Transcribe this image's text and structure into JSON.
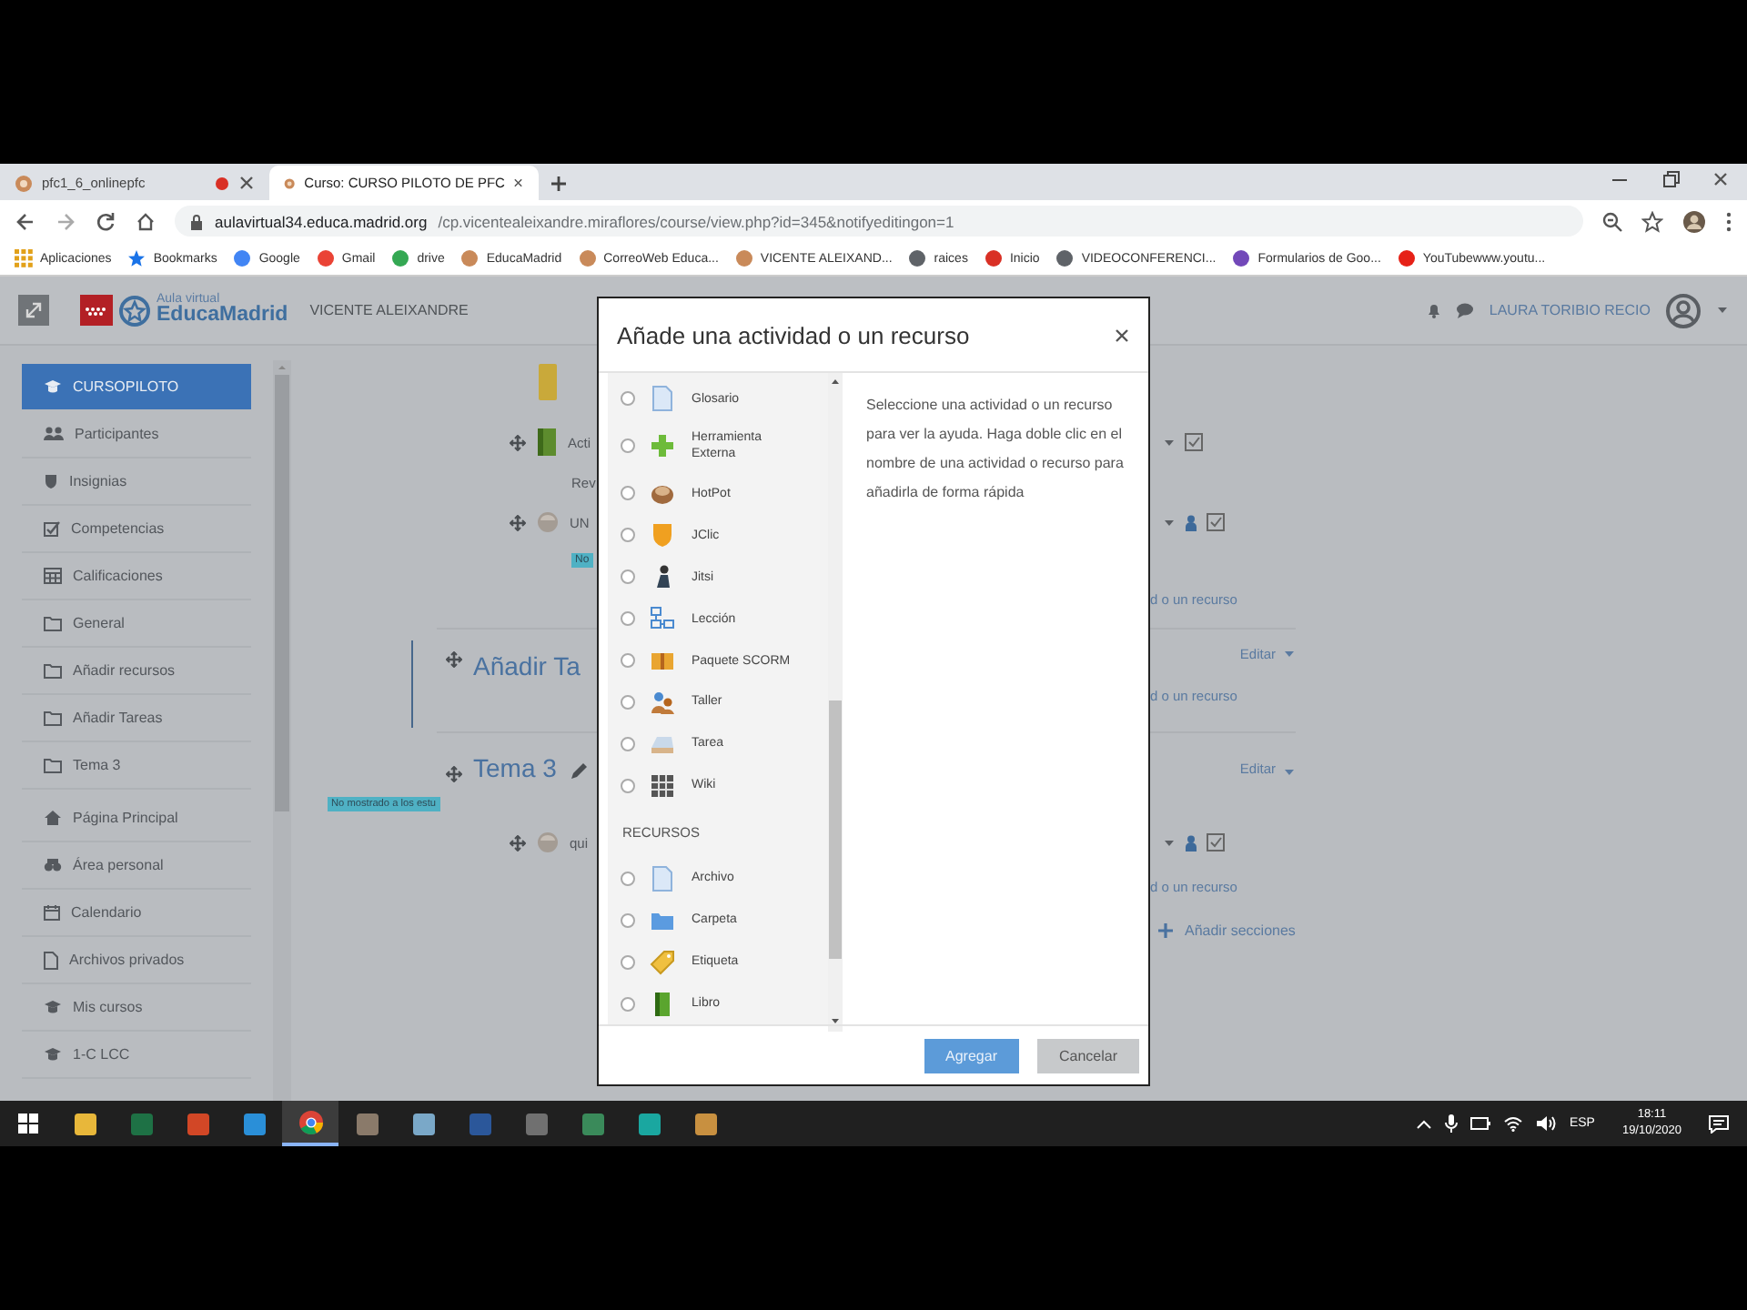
{
  "browser": {
    "tabs": [
      {
        "title": "pfc1_6_onlinepfc",
        "recording": true,
        "selected": false
      },
      {
        "title": "Curso: CURSO PILOTO DE PFC",
        "recording": false,
        "selected": true
      }
    ],
    "url_host": "aulavirtual34.educa.madrid.org",
    "url_path": "/cp.vicentealeixandre.miraflores/course/view.php?id=345&notifyeditingon=1",
    "bookmarks": [
      "Aplicaciones",
      "Bookmarks",
      "Google",
      "Gmail",
      "drive",
      "EducaMadrid",
      "CorreoWeb Educa...",
      "VICENTE ALEIXAND...",
      "raices",
      "Inicio",
      "VIDEOCONFERENCI...",
      "Formularios de Goo...",
      "YouTubewww.youtu..."
    ]
  },
  "header": {
    "logo_small": "Aula virtual",
    "logo": "EducaMadrid",
    "site": "VICENTE ALEIXANDRE",
    "user": "LAURA TORIBIO RECIO"
  },
  "sidebar": {
    "course_items": [
      {
        "label": "CURSOPILOTO",
        "selected": true
      },
      {
        "label": "Participantes",
        "selected": false
      },
      {
        "label": "Insignias",
        "selected": false
      },
      {
        "label": "Competencias",
        "selected": false
      },
      {
        "label": "Calificaciones",
        "selected": false
      },
      {
        "label": "General",
        "selected": false
      },
      {
        "label": "Añadir recursos",
        "selected": false
      },
      {
        "label": "Añadir Tareas",
        "selected": false
      },
      {
        "label": "Tema 3",
        "selected": false
      }
    ],
    "site_items": [
      {
        "label": "Página Principal",
        "selected": false
      },
      {
        "label": "Área personal",
        "selected": false
      },
      {
        "label": "Calendario",
        "selected": false
      },
      {
        "label": "Archivos privados",
        "selected": false
      },
      {
        "label": "Mis cursos",
        "selected": false
      },
      {
        "label": "1-C LCC",
        "selected": false
      }
    ]
  },
  "course": {
    "rows": [
      {
        "kind": "top",
        "left": [
          {
            "kind": "block"
          }
        ],
        "right": []
      },
      {
        "kind": "item",
        "left": [
          {
            "kind": "book",
            "text": "Acti"
          }
        ],
        "right": [
          {
            "kind": "actions"
          }
        ]
      },
      {
        "kind": "item",
        "left": [
          {
            "kind": "note",
            "text": "Rev"
          }
        ],
        "right": []
      },
      {
        "kind": "item",
        "left": [
          {
            "kind": "ball",
            "text": "UN"
          }
        ],
        "right": [
          {
            "kind": "useractions"
          }
        ]
      },
      {
        "kind": "badge",
        "left": [
          {
            "kind": "badge",
            "text": "No"
          }
        ],
        "right": []
      },
      {
        "kind": "item",
        "left": [],
        "right": [
          {
            "kind": "link",
            "text": "d o un recurso"
          }
        ]
      },
      {
        "kind": "section",
        "left": [
          {
            "kind": "heading",
            "text": "Añadir Ta"
          }
        ],
        "right": [
          {
            "kind": "edit",
            "text": "Editar"
          },
          {
            "kind": "link",
            "text": "d o un recurso"
          }
        ]
      },
      {
        "kind": "topic",
        "left": [
          {
            "kind": "title",
            "text": "Tema 3"
          }
        ],
        "right": [
          {
            "kind": "edit",
            "text": "Editar"
          }
        ]
      },
      {
        "kind": "badge",
        "left": [
          {
            "kind": "notice",
            "text": "No mostrado a los estu"
          }
        ],
        "right": []
      },
      {
        "kind": "item",
        "left": [
          {
            "kind": "ball",
            "text": "qui"
          }
        ],
        "right": [
          {
            "kind": "useractions"
          }
        ]
      },
      {
        "kind": "link",
        "left": [],
        "right": [
          {
            "kind": "link",
            "text": "d o un recurso"
          }
        ]
      },
      {
        "kind": "item",
        "left": [],
        "right": [
          {
            "kind": "add",
            "text": "Añadir secciones"
          }
        ]
      }
    ]
  },
  "modal": {
    "title": "Añade una actividad o un recurso",
    "activities": [
      {
        "label": "Glosario",
        "selected": false
      },
      {
        "label": "Herramienta Externa",
        "selected": false
      },
      {
        "label": "HotPot",
        "selected": false
      },
      {
        "label": "JClic",
        "selected": false
      },
      {
        "label": "Jitsi",
        "selected": false
      },
      {
        "label": "Lección",
        "selected": false
      },
      {
        "label": "Paquete SCORM",
        "selected": false
      },
      {
        "label": "Taller",
        "selected": false
      },
      {
        "label": "Tarea",
        "selected": false
      },
      {
        "label": "Wiki",
        "selected": false
      }
    ],
    "resources_heading": "RECURSOS",
    "resources": [
      {
        "label": "Archivo",
        "selected": false
      },
      {
        "label": "Carpeta",
        "selected": false
      },
      {
        "label": "Etiqueta",
        "selected": false
      },
      {
        "label": "Libro",
        "selected": false
      }
    ],
    "help": "Seleccione una actividad o un recurso para ver la ayuda. Haga doble clic en el nombre de una actividad o recurso para añadirla de forma rápida",
    "buttons": [
      {
        "label": "Agregar",
        "kind": "primary"
      },
      {
        "label": "Cancelar",
        "kind": "secondary"
      }
    ]
  },
  "taskbar": {
    "apps": [
      {
        "selected": false
      },
      {
        "selected": false
      },
      {
        "selected": false
      },
      {
        "selected": false
      },
      {
        "selected": true
      },
      {
        "selected": false
      },
      {
        "selected": false
      },
      {
        "selected": false
      },
      {
        "selected": false
      },
      {
        "selected": false
      },
      {
        "selected": false
      },
      {
        "selected": false
      }
    ],
    "language": "ESP",
    "time": "18:11",
    "date": "19/10/2020"
  }
}
